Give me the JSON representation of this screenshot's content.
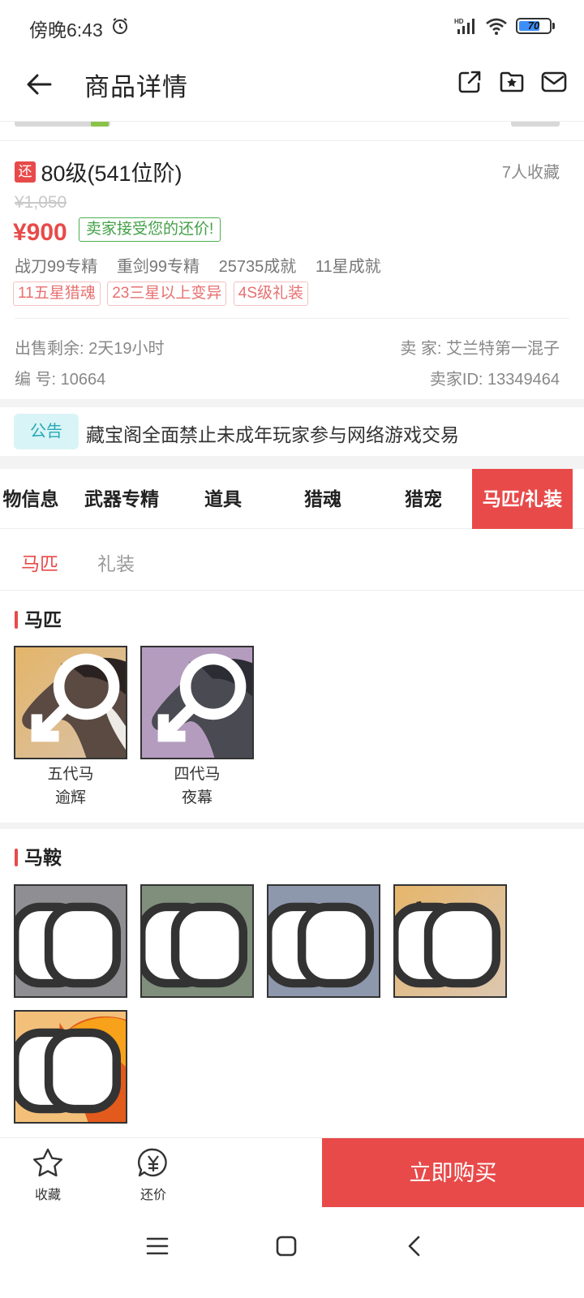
{
  "status_bar": {
    "time": "傍晚6:43",
    "battery": "70",
    "battery_level": 0.7
  },
  "header": {
    "title": "商品详情"
  },
  "product": {
    "return_badge": "还",
    "title": "80级(541位阶)",
    "fav_count": "7人收藏",
    "original_price": "¥1,050",
    "current_price": "¥900",
    "accept_tag": "卖家接受您的还价!",
    "specs": [
      "战刀99专精",
      "重剑99专精",
      "25735成就",
      "11星成就"
    ],
    "tags": [
      "11五星猎魂",
      "23三星以上变异",
      "4S级礼装"
    ],
    "remaining_label": "出售剩余: 2天19小时",
    "seller_label": "卖  家: 艾兰特第一混子",
    "serial_label": "编  号: 10664",
    "seller_id_label": "卖家ID: 13349464"
  },
  "notice": {
    "badge": "公告",
    "text": "藏宝阁全面禁止未成年玩家参与网络游戏交易"
  },
  "tabs": [
    {
      "label": "物信息",
      "active": false
    },
    {
      "label": "武器专精",
      "active": false
    },
    {
      "label": "道具",
      "active": false
    },
    {
      "label": "猎魂",
      "active": false
    },
    {
      "label": "猎宠",
      "active": false
    },
    {
      "label": "马匹/礼装",
      "active": true
    }
  ],
  "subtabs": [
    {
      "label": "马匹",
      "active": true
    },
    {
      "label": "礼装",
      "active": false
    }
  ],
  "horses": {
    "title": "马匹",
    "items": [
      {
        "line1": "五代马",
        "line2": "逾辉"
      },
      {
        "line1": "四代马",
        "line2": "夜幕"
      }
    ]
  },
  "saddles": {
    "title": "马鞍"
  },
  "bottom": {
    "favorite_label": "收藏",
    "bargain_label": "还价",
    "buy_label": "立即购买"
  },
  "colors": {
    "accent": "#e84a4a",
    "accept_green": "#43a047",
    "notice_teal": "#25a9b5"
  }
}
